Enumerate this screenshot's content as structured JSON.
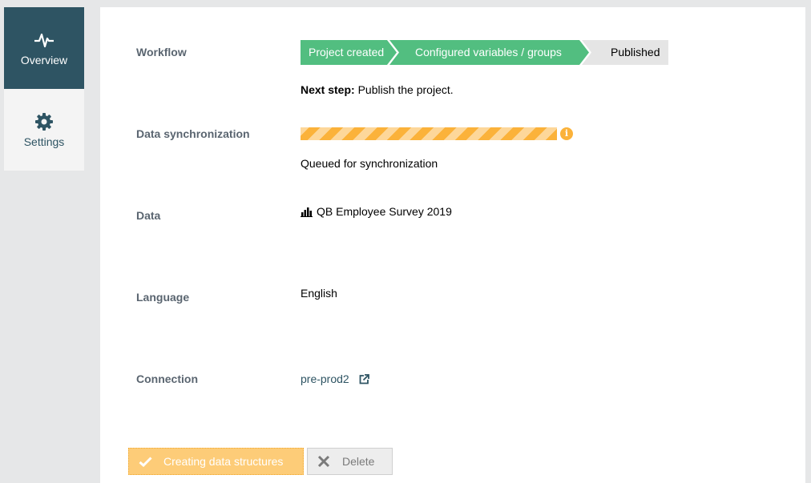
{
  "sidebar": {
    "items": [
      {
        "label": "Overview",
        "icon": "pulse-icon",
        "active": true
      },
      {
        "label": "Settings",
        "icon": "gear-icon",
        "active": false
      }
    ]
  },
  "overview": {
    "workflow": {
      "label": "Workflow",
      "steps": [
        {
          "label": "Project created",
          "status": "done"
        },
        {
          "label": "Configured variables / groups",
          "status": "done"
        },
        {
          "label": "Published",
          "status": "pending"
        }
      ],
      "next_step_prefix": "Next step:",
      "next_step_text": "Publish the project."
    },
    "sync": {
      "label": "Data synchronization",
      "status_text": "Queued for synchronization",
      "info_icon": "info-icon"
    },
    "data": {
      "label": "Data",
      "icon": "bar-chart-icon",
      "value": "QB Employee Survey 2019"
    },
    "language": {
      "label": "Language",
      "value": "English"
    },
    "connection": {
      "label": "Connection",
      "value": "pre-prod2",
      "icon": "external-link-icon"
    }
  },
  "actions": {
    "primary_label": "Creating data structures",
    "delete_label": "Delete"
  },
  "colors": {
    "accent": "#2e5463",
    "success": "#52be80",
    "warning": "#fbb23a"
  }
}
